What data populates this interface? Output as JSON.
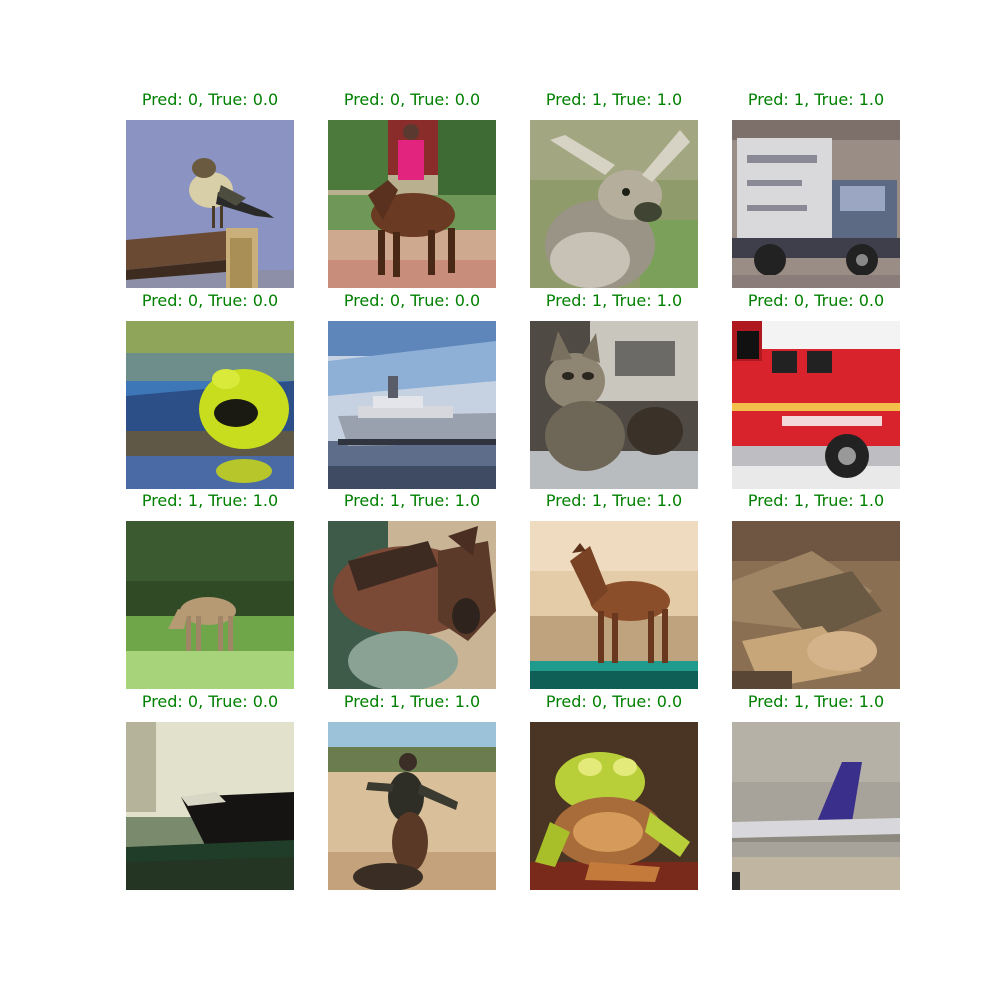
{
  "figure": {
    "panels": [
      {
        "title": "Pred: 0, True: 0.0",
        "subject": "bird"
      },
      {
        "title": "Pred: 0, True: 0.0",
        "subject": "horse"
      },
      {
        "title": "Pred: 1, True: 1.0",
        "subject": "deer"
      },
      {
        "title": "Pred: 1, True: 1.0",
        "subject": "truck"
      },
      {
        "title": "Pred: 0, True: 0.0",
        "subject": "frog"
      },
      {
        "title": "Pred: 0, True: 0.0",
        "subject": "ship"
      },
      {
        "title": "Pred: 1, True: 1.0",
        "subject": "cat"
      },
      {
        "title": "Pred: 0, True: 0.0",
        "subject": "truck"
      },
      {
        "title": "Pred: 1, True: 1.0",
        "subject": "deer"
      },
      {
        "title": "Pred: 1, True: 1.0",
        "subject": "horse"
      },
      {
        "title": "Pred: 1, True: 1.0",
        "subject": "horse"
      },
      {
        "title": "Pred: 1, True: 1.0",
        "subject": "frog"
      },
      {
        "title": "Pred: 0, True: 0.0",
        "subject": "ship"
      },
      {
        "title": "Pred: 1, True: 1.0",
        "subject": "horse"
      },
      {
        "title": "Pred: 0, True: 0.0",
        "subject": "frog"
      },
      {
        "title": "Pred: 1, True: 1.0",
        "subject": "airplane"
      }
    ],
    "title_color": "#008000"
  }
}
